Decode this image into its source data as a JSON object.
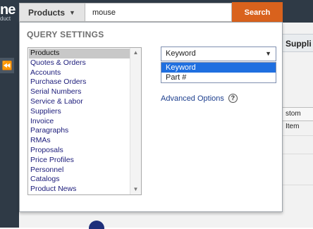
{
  "app": {
    "logo_text": "ne",
    "logo_subtext": "duct"
  },
  "search": {
    "scope_label": "Products",
    "query_value": "mouse",
    "search_label": "Search"
  },
  "query_settings": {
    "title": "QUERY SETTINGS",
    "types": [
      "Products",
      "Quotes & Orders",
      "Accounts",
      "Purchase Orders",
      "Serial Numbers",
      "Service & Labor",
      "Suppliers",
      "Invoice",
      "Paragraphs",
      "RMAs",
      "Proposals",
      "Price Profiles",
      "Personnel",
      "Catalogs",
      "Product News"
    ],
    "selected_type": "Products",
    "search_by_selected": "Keyword",
    "search_by_options": [
      "Keyword",
      "Part #"
    ],
    "advanced_label": "Advanced Options",
    "help_label": "?"
  },
  "background": {
    "tab_label": "Suppli",
    "button_label": "stom Item"
  },
  "colors": {
    "search_button": "#d9621d",
    "header_bg": "#2f3a46",
    "option_highlight": "#1f6fe0",
    "list_selected": "#c8c8c8"
  }
}
